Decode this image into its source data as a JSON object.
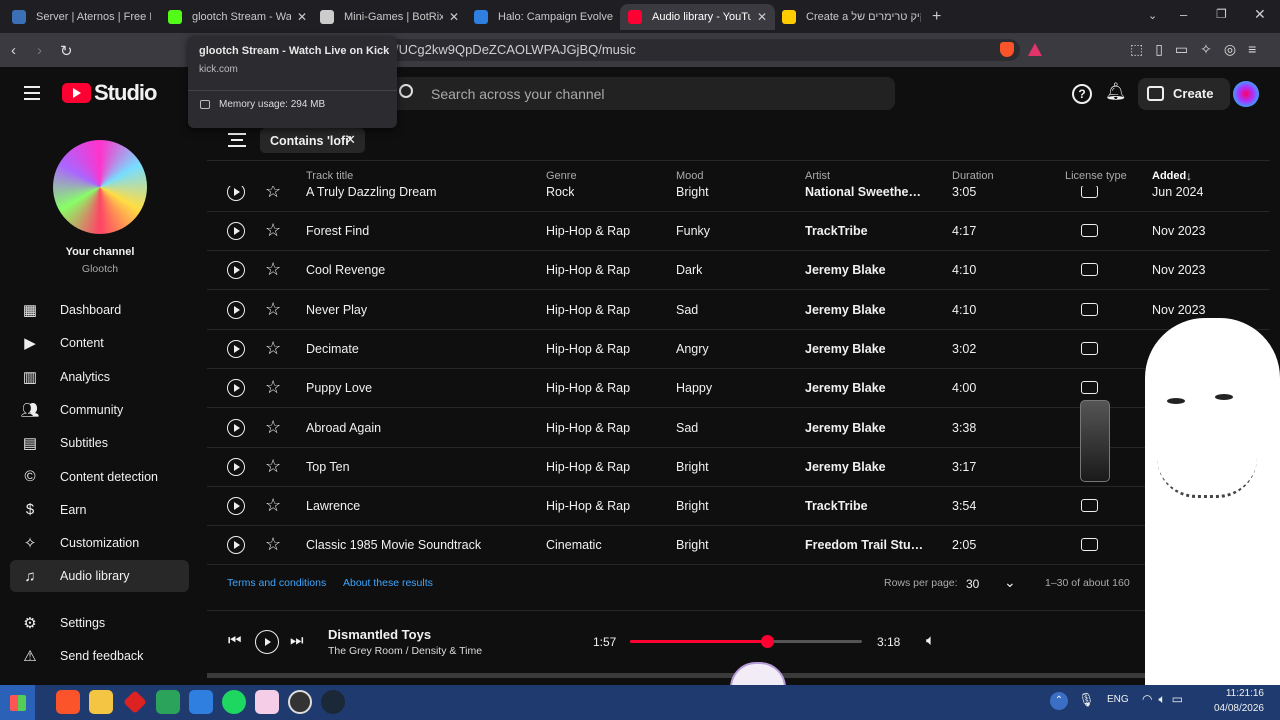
{
  "browser": {
    "tabs": [
      {
        "label": "Server | Aternos | Free Mi",
        "color": "#3b6fb6"
      },
      {
        "label": "glootch Stream - Wa",
        "color": "#53fc18"
      },
      {
        "label": "Mini-Games | BotRix — C",
        "color": "#cccccc"
      },
      {
        "label": "Halo: Campaign Evolved",
        "color": "#2f7fe0"
      },
      {
        "label": "Audio library - YouTu",
        "color": "#ff0033"
      },
      {
        "label": "Create a קיק טרימרים של",
        "color": "#ffcc00"
      }
    ],
    "url": "/UCg2kw9QpDeZCAOLWPAJGjBQ/music",
    "tooltip": {
      "title": "glootch Stream - Watch Live on Kick",
      "domain": "kick.com",
      "memory": "Memory usage: 294 MB"
    }
  },
  "header": {
    "logo": "Studio",
    "search_placeholder": "Search across your channel",
    "create_label": "Create"
  },
  "channel": {
    "label": "Your channel",
    "name": "Glootch"
  },
  "sidebar": {
    "items": [
      {
        "label": "Dashboard",
        "icon": "dashboard-icon"
      },
      {
        "label": "Content",
        "icon": "content-icon"
      },
      {
        "label": "Analytics",
        "icon": "analytics-icon"
      },
      {
        "label": "Community",
        "icon": "community-icon"
      },
      {
        "label": "Subtitles",
        "icon": "subtitles-icon"
      },
      {
        "label": "Content detection",
        "icon": "copyright-icon"
      },
      {
        "label": "Earn",
        "icon": "dollar-icon"
      },
      {
        "label": "Customization",
        "icon": "magic-wand-icon"
      },
      {
        "label": "Audio library",
        "icon": "audio-library-icon"
      }
    ],
    "settings": "Settings",
    "feedback": "Send feedback"
  },
  "filter": {
    "chip": "Contains 'lofi'"
  },
  "table": {
    "columns": [
      "Track title",
      "Genre",
      "Mood",
      "Artist",
      "Duration",
      "License type",
      "Added"
    ],
    "partial_row": {
      "title": "A Truly Dazzling Dream",
      "genre": "Rock",
      "mood": "Bright",
      "artist": "National Sweethe…",
      "duration": "3:05",
      "added": "Jun 2024"
    },
    "rows": [
      {
        "title": "Forest Find",
        "genre": "Hip-Hop & Rap",
        "mood": "Funky",
        "artist": "TrackTribe",
        "duration": "4:17",
        "added": "Nov 2023"
      },
      {
        "title": "Cool Revenge",
        "genre": "Hip-Hop & Rap",
        "mood": "Dark",
        "artist": "Jeremy Blake",
        "duration": "4:10",
        "added": "Nov 2023"
      },
      {
        "title": "Never Play",
        "genre": "Hip-Hop & Rap",
        "mood": "Sad",
        "artist": "Jeremy Blake",
        "duration": "4:10",
        "added": "Nov 2023"
      },
      {
        "title": "Decimate",
        "genre": "Hip-Hop & Rap",
        "mood": "Angry",
        "artist": "Jeremy Blake",
        "duration": "3:02",
        "added": ""
      },
      {
        "title": "Puppy Love",
        "genre": "Hip-Hop & Rap",
        "mood": "Happy",
        "artist": "Jeremy Blake",
        "duration": "4:00",
        "added": ""
      },
      {
        "title": "Abroad Again",
        "genre": "Hip-Hop & Rap",
        "mood": "Sad",
        "artist": "Jeremy Blake",
        "duration": "3:38",
        "added": ""
      },
      {
        "title": "Top Ten",
        "genre": "Hip-Hop & Rap",
        "mood": "Bright",
        "artist": "Jeremy Blake",
        "duration": "3:17",
        "added": ""
      },
      {
        "title": "Lawrence",
        "genre": "Hip-Hop & Rap",
        "mood": "Bright",
        "artist": "TrackTribe",
        "duration": "3:54",
        "added": "Ju"
      },
      {
        "title": "Classic 1985 Movie Soundtrack",
        "genre": "Cinematic",
        "mood": "Bright",
        "artist": "Freedom Trail Stu…",
        "duration": "2:05",
        "added": "Dec 20"
      }
    ]
  },
  "footer": {
    "terms": "Terms and conditions",
    "about": "About these results",
    "rows_label": "Rows per page:",
    "rows_value": "30",
    "range": "1–30 of about 160"
  },
  "player": {
    "title": "Dismantled Toys",
    "artist": "The Grey Room / Density & Time",
    "elapsed": "1:57",
    "total": "3:18",
    "progress_fraction": 0.59
  },
  "taskbar": {
    "lang": "ENG",
    "time": "11:21:16",
    "date": "04/08/2026"
  },
  "colors": {
    "accent": "#ff0033",
    "link": "#3ea6ff"
  }
}
